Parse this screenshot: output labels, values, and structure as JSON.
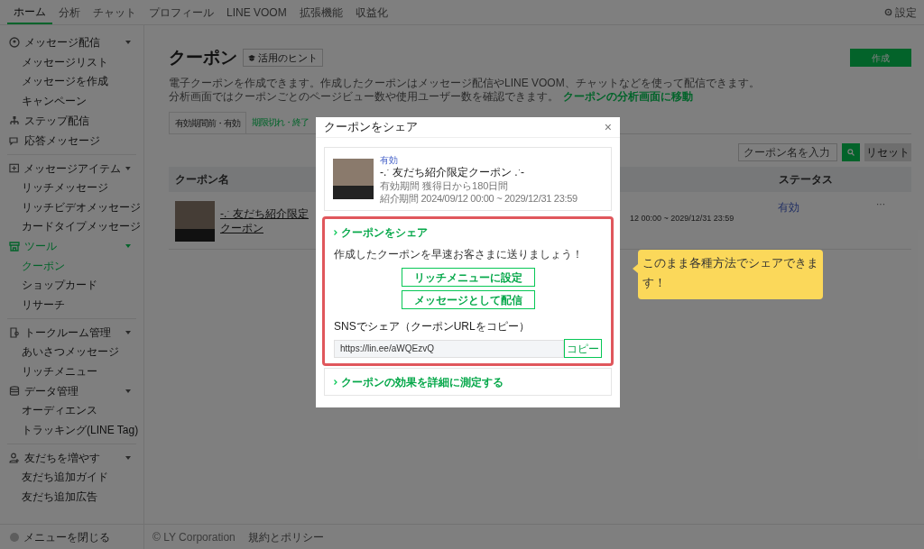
{
  "top_nav": {
    "tabs": [
      {
        "label": "ホーム",
        "selected": true
      },
      {
        "label": "分析",
        "selected": false
      },
      {
        "label": "チャット",
        "selected": false
      },
      {
        "label": "プロフィール",
        "selected": false
      },
      {
        "label": "LINE VOOM",
        "selected": false
      },
      {
        "label": "拡張機能",
        "selected": false
      },
      {
        "label": "収益化",
        "selected": false
      }
    ],
    "settings": "設定"
  },
  "sidebar": {
    "groups": [
      {
        "label": "メッセージ配信",
        "expandable": true,
        "selected": false,
        "children": [
          {
            "label": "メッセージリスト",
            "selected": false
          },
          {
            "label": "メッセージを作成",
            "selected": false
          },
          {
            "label": "キャンペーン",
            "selected": false
          }
        ]
      },
      {
        "label": "ステップ配信",
        "expandable": false,
        "selected": false
      },
      {
        "label": "応答メッセージ",
        "expandable": false,
        "selected": false,
        "divider_after": true
      },
      {
        "label": "メッセージアイテム",
        "expandable": true,
        "selected": false,
        "children": [
          {
            "label": "リッチメッセージ",
            "selected": false
          },
          {
            "label": "リッチビデオメッセージ",
            "selected": false
          },
          {
            "label": "カードタイプメッセージ",
            "selected": false
          }
        ]
      },
      {
        "label": "ツール",
        "expandable": true,
        "selected": true,
        "divider_after": true,
        "children": [
          {
            "label": "クーポン",
            "selected": true
          },
          {
            "label": "ショップカード",
            "selected": false
          },
          {
            "label": "リサーチ",
            "selected": false
          }
        ]
      },
      {
        "label": "トークルーム管理",
        "expandable": true,
        "selected": false,
        "children": [
          {
            "label": "あいさつメッセージ",
            "selected": false
          },
          {
            "label": "リッチメニュー",
            "selected": false
          }
        ]
      },
      {
        "label": "データ管理",
        "expandable": true,
        "selected": false,
        "divider_after": true,
        "children": [
          {
            "label": "オーディエンス",
            "selected": false
          },
          {
            "label": "トラッキング(LINE Tag)",
            "selected": false
          }
        ]
      },
      {
        "label": "友だちを増やす",
        "expandable": true,
        "selected": false,
        "children": [
          {
            "label": "友だち追加ガイド",
            "selected": false
          },
          {
            "label": "友だち追加広告",
            "selected": false
          }
        ]
      }
    ],
    "close_menu": "メニューを閉じる"
  },
  "main": {
    "title": "クーポン",
    "hint_button": "活用のヒント",
    "create_button": "作成",
    "description": "電子クーポンを作成できます。作成したクーポンはメッセージ配信やLINE VOOM、チャットなどを使って配信できます。",
    "description_2": "分析画面ではクーポンごとのページビュー数や使用ユーザー数を確認できます。",
    "analysis_link": "クーポンの分析画面に移動",
    "tabs": [
      {
        "label": "有効期間前・有効",
        "selected": true
      },
      {
        "label": "期限切れ・終了",
        "selected": false
      }
    ],
    "search": {
      "placeholder": "クーポン名を入力"
    },
    "reset_button": "リセット",
    "table": {
      "columns": [
        "クーポン名",
        "ステータス"
      ],
      "rows": [
        {
          "name": "-.ˑ 友だち紹介限定クーポン",
          "period": "12 00:00 ~ 2029/12/31 23:59",
          "status": "有効",
          "menu": "···"
        }
      ]
    }
  },
  "footer": {
    "copyright": "© LY Corporation",
    "policy": "規約とポリシー"
  },
  "dialog": {
    "title": "クーポンをシェア",
    "close": "×",
    "coupon": {
      "status": "有効",
      "name": "-.ˑ 友だち紹介限定クーポン .ˑ-",
      "validity": "有効期間 獲得日から180日間",
      "period": "紹介期間 2024/09/12 00:00 ~ 2029/12/31 23:59"
    },
    "share_section": {
      "heading": "クーポンをシェア",
      "text": "作成したクーポンを早速お客さまに送りましょう！",
      "buttons": [
        "リッチメニューに設定",
        "メッセージとして配信"
      ],
      "sns_label": "SNSでシェア（クーポンURLをコピー）",
      "url": "https://lin.ee/aWQEzvQ",
      "copy_button": "コピー"
    },
    "measure_link": "クーポンの効果を詳細に測定する"
  },
  "callout": {
    "text": "このまま各種方法でシェアできます！"
  }
}
